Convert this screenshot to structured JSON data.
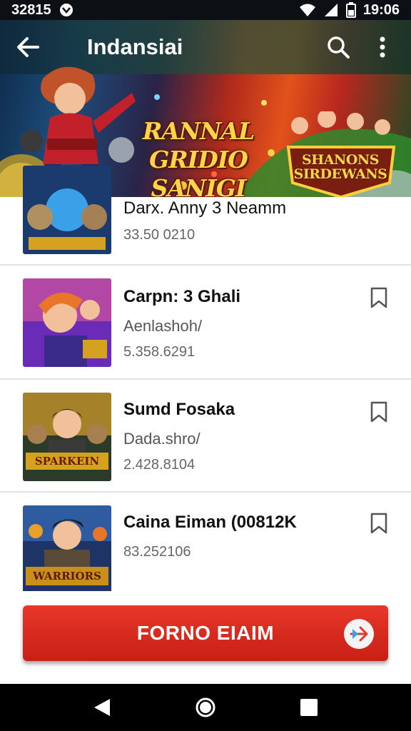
{
  "status_bar": {
    "time_left": "32815",
    "time_right": "19:06"
  },
  "app_bar": {
    "title": "Indansiai"
  },
  "hero": {
    "headline_line1": "RANNAL GRIDIO",
    "headline_line2": "SANIGI SAIOO",
    "badge_line1": "SHANONS",
    "badge_line2": "SIRDEWANS"
  },
  "games": [
    {
      "name": "Darx. Anny 3 Neamm",
      "subtitle": "",
      "meta": "33.50 0210",
      "bookmark": false
    },
    {
      "name": "Carpn: 3 Ghali",
      "subtitle": "Aenlashoh/",
      "meta": "5.358.6291",
      "bookmark": true
    },
    {
      "name": "Sumd Fosaka",
      "subtitle": "Dada.shro/",
      "meta": "2.428.8104",
      "bookmark": true
    },
    {
      "name": "Caina Eiman (00812K",
      "subtitle": "",
      "meta": "83.252106",
      "bookmark": true
    }
  ],
  "thumb_captions": {
    "t3_line1": "SPARKEIN",
    "t4_line1": "WARRIORS"
  },
  "cta": {
    "label": "FORNO EIAIM"
  },
  "colors": {
    "accent": "#d42a1f",
    "status_bar": "#0c0f14",
    "nav_bar": "#000000"
  },
  "icons": {
    "back": "arrow-left-icon",
    "search": "search-icon",
    "more": "more-vert-icon",
    "bookmark": "bookmark-outline-icon",
    "cta": "send-icon",
    "nav_back": "triangle-back-icon",
    "nav_home": "circle-home-icon",
    "nav_recents": "square-recents-icon"
  }
}
